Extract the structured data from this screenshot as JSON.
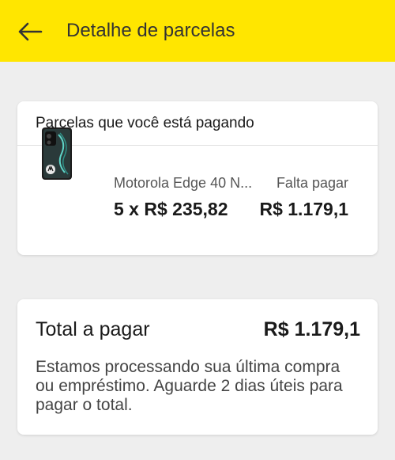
{
  "header": {
    "title": "Detalhe de parcelas",
    "back_icon": "arrow-left-icon"
  },
  "installments_card": {
    "title": "Parcelas que você está pagando",
    "product": {
      "name": "Motorola Edge 40 N...",
      "installment": "5 x R$ 235,82",
      "remaining_label": "Falta pagar",
      "remaining_value": "R$ 1.179,1"
    }
  },
  "total_card": {
    "label": "Total a pagar",
    "value": "R$ 1.179,1",
    "note": "Estamos processando sua última compra ou empréstimo. Aguarde 2 dias úteis para pagar o total."
  },
  "colors": {
    "header_bg": "#ffe600",
    "page_bg": "#eeeeee",
    "card_bg": "#ffffff"
  }
}
